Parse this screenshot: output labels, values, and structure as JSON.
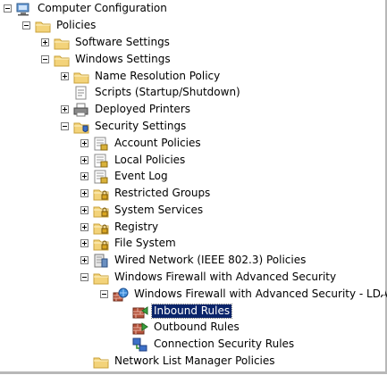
{
  "tree": {
    "items": [
      {
        "label": "Computer Configuration",
        "toggle": "minus",
        "icon": "computer-icon"
      },
      {
        "label": "Policies",
        "toggle": "minus",
        "icon": "folder-icon"
      },
      {
        "label": "Software Settings",
        "toggle": "plus",
        "icon": "folder-icon"
      },
      {
        "label": "Windows Settings",
        "toggle": "minus",
        "icon": "folder-icon"
      },
      {
        "label": "Name Resolution Policy",
        "toggle": "plus",
        "icon": "folder-icon"
      },
      {
        "label": "Scripts (Startup/Shutdown)",
        "toggle": "none",
        "icon": "script-icon"
      },
      {
        "label": "Deployed Printers",
        "toggle": "plus",
        "icon": "printer-icon"
      },
      {
        "label": "Security Settings",
        "toggle": "minus",
        "icon": "security-settings-icon"
      },
      {
        "label": "Account Policies",
        "toggle": "plus",
        "icon": "policy-icon"
      },
      {
        "label": "Local Policies",
        "toggle": "plus",
        "icon": "policy-icon"
      },
      {
        "label": "Event Log",
        "toggle": "plus",
        "icon": "policy-icon"
      },
      {
        "label": "Restricted Groups",
        "toggle": "plus",
        "icon": "locked-folder-icon"
      },
      {
        "label": "System Services",
        "toggle": "plus",
        "icon": "locked-folder-icon"
      },
      {
        "label": "Registry",
        "toggle": "plus",
        "icon": "locked-folder-icon"
      },
      {
        "label": "File System",
        "toggle": "plus",
        "icon": "locked-folder-icon"
      },
      {
        "label": "Wired Network (IEEE 802.3) Policies",
        "toggle": "plus",
        "icon": "network-policy-icon"
      },
      {
        "label": "Windows Firewall with Advanced Security",
        "toggle": "minus",
        "icon": "folder-icon"
      },
      {
        "label": "Windows Firewall with Advanced Security - LDAP://",
        "toggle": "minus",
        "icon": "firewall-icon"
      },
      {
        "label": "Inbound Rules",
        "toggle": "none",
        "icon": "inbound-rules-icon",
        "selected": true
      },
      {
        "label": "Outbound Rules",
        "toggle": "none",
        "icon": "outbound-rules-icon"
      },
      {
        "label": "Connection Security Rules",
        "toggle": "none",
        "icon": "connection-security-icon"
      },
      {
        "label": "Network List Manager Policies",
        "toggle": "none",
        "icon": "folder-icon"
      }
    ]
  },
  "colors": {
    "selection": "#0a246a",
    "folder": "#f3d37a",
    "folder_edge": "#c9a23a"
  }
}
